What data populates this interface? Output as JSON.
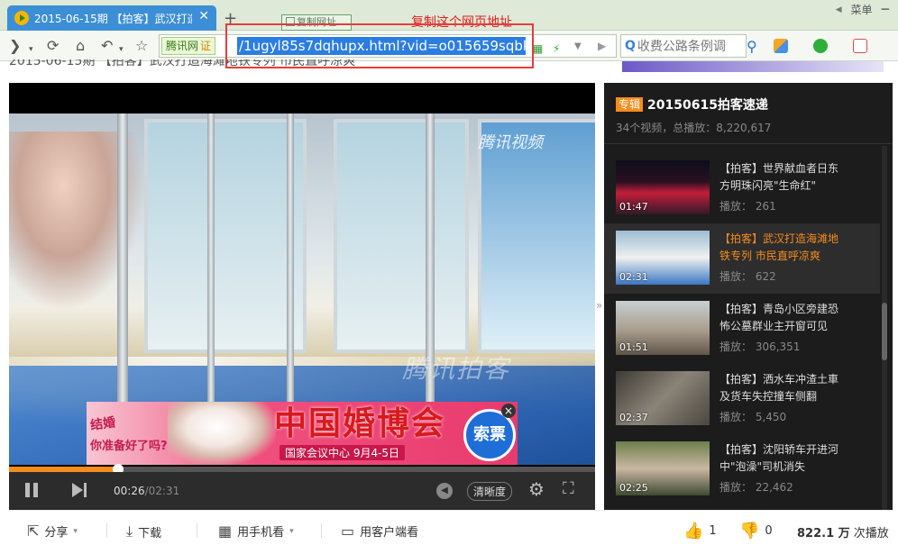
{
  "browser": {
    "tab_title": "2015-06-15期 【拍客】武汉打造",
    "tab_close": "✕",
    "new_tab": "+",
    "copy_url_hint": "复制网址",
    "annotation": "复制这个网页地址",
    "menu_label": "菜单",
    "site_badge": "腾讯网",
    "cert_label": "证",
    "url": "/1ugyl85s7dqhupx.html?vid=o015659sqbk",
    "search_placeholder": "收费公路条例调",
    "icons": [
      "back-icon",
      "refresh-icon",
      "home-icon",
      "undo-icon",
      "star-icon",
      "search-icon"
    ]
  },
  "page": {
    "subline": "2015-06-15期 【拍客】武汉打造海滩地铁专列 市民直呼凉爽"
  },
  "player": {
    "watermark": "腾讯视频",
    "watermark2": "腾讯拍客",
    "ad": {
      "left_text": "结婚",
      "left_sub": "你准备好了吗?",
      "title": "中国婚博会",
      "venue": "国家会议中心  9月4-5日",
      "button": "索票",
      "close": "×"
    },
    "progress": 0.186,
    "current_time": "00:26",
    "duration": "/02:31",
    "quality": "清晰度"
  },
  "playlist": {
    "tag": "专辑",
    "title": "20150615拍客速递",
    "meta": "34个视频，总播放：8,220,617",
    "items": [
      {
        "title": "【拍客】世界献血者日东方明珠闪亮\"生命红\"",
        "plays": "播放：  261",
        "duration": "01:47",
        "active": false
      },
      {
        "title": "【拍客】武汉打造海滩地铁专列 市民直呼凉爽",
        "plays": "播放：  622",
        "duration": "02:31",
        "active": true
      },
      {
        "title": "【拍客】青岛小区旁建恐怖公墓群业主开窗可见",
        "plays": "播放：  306,351",
        "duration": "01:51",
        "active": false
      },
      {
        "title": "【拍客】洒水车冲渣土車及货车失控撞车侧翻",
        "plays": "播放：  5,450",
        "duration": "02:37",
        "active": false
      },
      {
        "title": "【拍客】沈阳轿车开进河中\"泡澡\"司机消失",
        "plays": "播放：  22,462",
        "duration": "02:25",
        "active": false
      }
    ]
  },
  "actions": {
    "share": "分享",
    "download": "下载",
    "mobile": "用手机看",
    "client": "用客户端看",
    "likes": "1",
    "dislikes": "0",
    "plays_value": "822.1 万",
    "plays_suffix": " 次播放"
  }
}
